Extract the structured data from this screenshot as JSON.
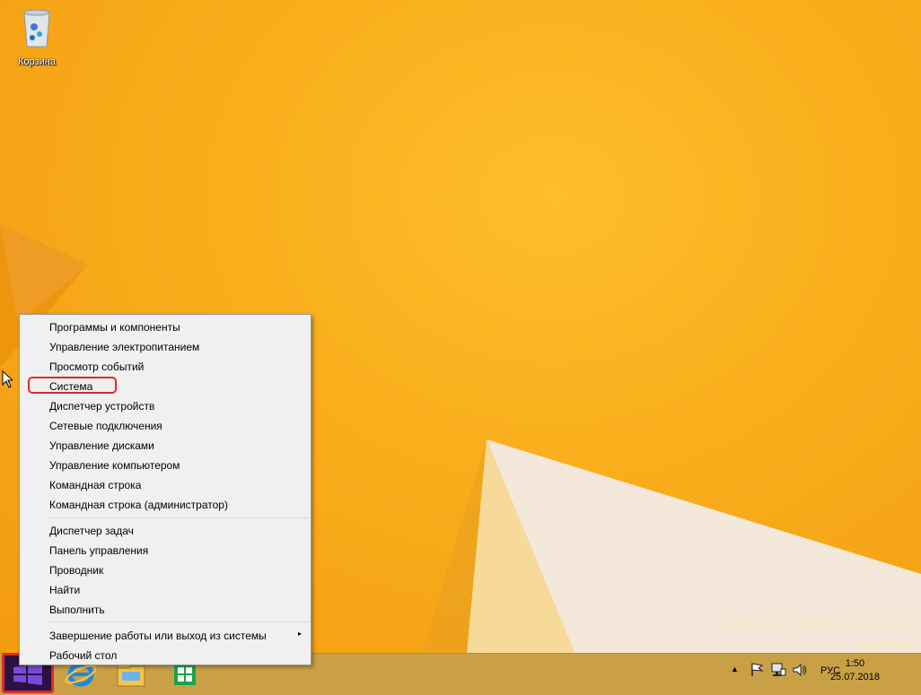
{
  "desktop": {
    "icons": [
      {
        "label": "Корзина",
        "icon": "recycle-bin-icon"
      }
    ],
    "watermark": {
      "line1": "Windows 8.1 Профессиональная",
      "line2": "Build 9600"
    }
  },
  "context_menu": {
    "group1": [
      "Программы и компоненты",
      "Управление электропитанием",
      "Просмотр событий",
      "Система",
      "Диспетчер устройств",
      "Сетевые подключения",
      "Управление дисками",
      "Управление компьютером",
      "Командная строка",
      "Командная строка (администратор)"
    ],
    "group2": [
      "Диспетчер задач",
      "Панель управления",
      "Проводник",
      "Найти",
      "Выполнить"
    ],
    "group3": [
      "Завершение работы или выход из системы",
      "Рабочий стол"
    ],
    "submenu_arrow": "▸",
    "highlight_color": "#e0282a"
  },
  "taskbar": {
    "pinned": [
      "internet-explorer-icon",
      "file-explorer-icon",
      "store-icon"
    ],
    "language": "РУС",
    "time": "1:50",
    "date": "25.07.2018",
    "tray_icons": [
      "show-hidden-icons-icon",
      "action-center-flag-icon",
      "network-icon",
      "volume-icon"
    ],
    "tray_arrow": "▲"
  }
}
